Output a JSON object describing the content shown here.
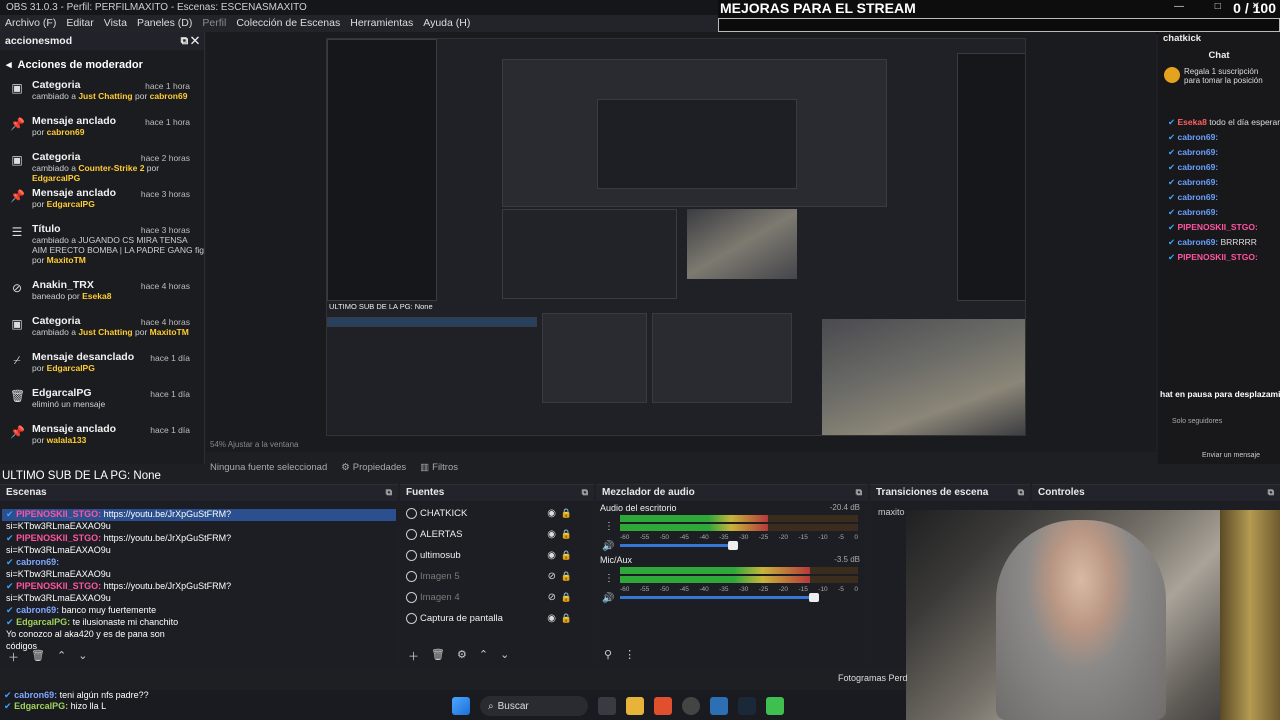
{
  "window": {
    "title": "OBS 31.0.3 - Perfil: PERFILMAXITO - Escenas: ESCENASMAXITO",
    "controls": "— □ ✕"
  },
  "menu": [
    "Archivo (F)",
    "Editar",
    "Vista",
    "Paneles (D)",
    "Perfil",
    "Colección de Escenas",
    "Herramientas",
    "Ayuda (H)"
  ],
  "goal": {
    "title": "MEJORAS PARA EL STREAM",
    "count": "0  / 100",
    "progress": 0.0
  },
  "mod_panel": {
    "dock_title": "accionesmod",
    "header": "Acciones de moderador",
    "entries": [
      {
        "icon": "category-icon",
        "title": "Categoria",
        "time": "hace 1 hora",
        "desc": "cambiado a ",
        "hl": "Just Chatting",
        "desc2": " por ",
        "user": "cabron69"
      },
      {
        "icon": "pin-icon",
        "title": "Mensaje anclado",
        "time": "hace 1 hora",
        "desc": "por ",
        "hl": "",
        "desc2": "",
        "user": "cabron69"
      },
      {
        "icon": "category-icon",
        "title": "Categoria",
        "time": "hace 2 horas",
        "desc": "cambiado a ",
        "hl": "Counter-Strike 2",
        "desc2": " por ",
        "user": "EdgarcalPG"
      },
      {
        "icon": "pin-icon",
        "title": "Mensaje anclado",
        "time": "hace 3 horas",
        "desc": "por ",
        "hl": "",
        "desc2": "",
        "user": "EdgarcalPG"
      },
      {
        "icon": "title-icon",
        "title": "Título",
        "time": "hace 3 horas",
        "desc": "cambiado a JUGANDO CS MIRA TENSA AIM ERECTO BOMBA | LA PADRE GANG fig por ",
        "hl": "",
        "desc2": "",
        "user": "MaxitoTM"
      },
      {
        "icon": "ban-icon",
        "title": "Anakin_TRX",
        "time": "hace 4 horas",
        "desc": "baneado por ",
        "hl": "",
        "desc2": "",
        "user": "Eseka8"
      },
      {
        "icon": "category-icon",
        "title": "Categoria",
        "time": "hace 4 horas",
        "desc": "cambiado a ",
        "hl": "Just Chatting",
        "desc2": " por ",
        "user": "MaxitoTM"
      },
      {
        "icon": "unpin-icon",
        "title": "Mensaje desanclado",
        "time": "hace 1 día",
        "desc": "por ",
        "hl": "",
        "desc2": "",
        "user": "EdgarcalPG"
      },
      {
        "icon": "trash-icon",
        "title": "EdgarcalPG",
        "time": "hace 1 día",
        "desc": "eliminó un mensaje",
        "hl": "",
        "desc2": "",
        "user": ""
      },
      {
        "icon": "pin-icon",
        "title": "Mensaje anclado",
        "time": "hace 1 día",
        "desc": "por ",
        "hl": "",
        "desc2": "",
        "user": "walala133"
      }
    ]
  },
  "preview": {
    "inner_status_text": "ULTIMO SUB DE LA PG: None",
    "zoom_text": "54%   Ajustar a la ventana"
  },
  "chat": {
    "dock_title": "chatkick",
    "title": "Chat",
    "promo": "Regala 1 suscripción para tomar la posición",
    "lines": [
      {
        "user": "Eseka8",
        "msg": "todo el día esperando el fila...",
        "cls": "u-esk"
      },
      {
        "user": "cabron69:",
        "msg": "",
        "cls": "u-cab"
      },
      {
        "user": "cabron69:",
        "msg": "",
        "cls": "u-cab"
      },
      {
        "user": "cabron69:",
        "msg": "",
        "cls": "u-cab"
      },
      {
        "user": "cabron69:",
        "msg": "",
        "cls": "u-cab"
      },
      {
        "user": "cabron69:",
        "msg": "",
        "cls": "u-cab"
      },
      {
        "user": "cabron69:",
        "msg": "",
        "cls": "u-cab"
      },
      {
        "user": "PIPENOSKII_STGO:",
        "msg": "",
        "cls": "u-pip"
      },
      {
        "user": "cabron69:",
        "msg": "BRRRRR",
        "cls": "u-cab"
      },
      {
        "user": "PIPENOSKII_STGO:",
        "msg": "",
        "cls": "u-pip"
      }
    ],
    "paused": "hat en pausa para desplazamie",
    "followers_only": "Solo seguidores",
    "send": "Enviar un mensaje"
  },
  "overlay_text": "ULTIMO SUB DE LA PG: None",
  "source_toolbar": {
    "no_source": "Ninguna fuente seleccionad",
    "properties": "Propiedades",
    "filters": "Filtros"
  },
  "docks": {
    "scenes": "Escenas",
    "sources": "Fuentes",
    "mixer": "Mezclador de audio",
    "transitions": "Transiciones de escena",
    "controls": "Controles"
  },
  "scene_chat": [
    {
      "name": "PIPENOSKII_STGO:",
      "msg": "https://youtu.be/JrXpGuStFRM?",
      "cls": "nm-pip",
      "hl": true
    },
    {
      "name": "",
      "msg": "si=KTbw3RLmaEAXAO9u",
      "cls": "",
      "hl": false
    },
    {
      "name": "PIPENOSKII_STGO:",
      "msg": "https://youtu.be/JrXpGuStFRM?",
      "cls": "nm-pip",
      "hl": false
    },
    {
      "name": "",
      "msg": "si=KTbw3RLmaEAXAO9u",
      "cls": "",
      "hl": false
    },
    {
      "name": "cabron69:",
      "msg": "",
      "cls": "nm-cab",
      "hl": false
    },
    {
      "name": "",
      "msg": "si=KTbw3RLmaEAXAO9u",
      "cls": "",
      "hl": false
    },
    {
      "name": "PIPENOSKII_STGO:",
      "msg": "https://youtu.be/JrXpGuStFRM?",
      "cls": "nm-pip",
      "hl": false
    },
    {
      "name": "",
      "msg": "si=KTbw3RLmaEAXAO9u",
      "cls": "",
      "hl": false
    },
    {
      "name": "cabron69:",
      "msg": "banco muy fuertemente",
      "cls": "nm-cab",
      "hl": false
    },
    {
      "name": "EdgarcalPG:",
      "msg": "te ilusionaste mi chanchito",
      "cls": "nm-edg",
      "hl": false
    },
    {
      "name": "",
      "msg": "Yo conozco al aka420 y es de pana son",
      "cls": "",
      "hl": false
    },
    {
      "name": "",
      "msg": "códigos",
      "cls": "",
      "hl": false
    }
  ],
  "sources": [
    {
      "name": "CHATKICK",
      "off": false
    },
    {
      "name": "ALERTAS",
      "off": false
    },
    {
      "name": "ultimosub",
      "off": false
    },
    {
      "name": "Imagen 5",
      "off": true
    },
    {
      "name": "Imagen 4",
      "off": true
    },
    {
      "name": "Captura de pantalla",
      "off": false
    }
  ],
  "mixer": [
    {
      "name": "Audio del escritorio",
      "db": "-20.4 dB",
      "level": 0.62,
      "fader": 0.48
    },
    {
      "name": "Mic/Aux",
      "db": "-3.5 dB",
      "level": 0.8,
      "fader": 0.82
    }
  ],
  "mixer_ticks": [
    "-60",
    "-55",
    "-50",
    "-45",
    "-40",
    "-35",
    "-30",
    "-25",
    "-20",
    "-15",
    "-10",
    "-5",
    "0"
  ],
  "transition_name": "maxito",
  "fps_text": "Fotogramas Perd",
  "taskbar": {
    "chat_line1": "teni algún nfs padre??",
    "chat_line1_user": "cabron69:",
    "chat_line2_user": "EdgarcalPG:",
    "chat_line2": "hizo lla L",
    "search": "Buscar"
  },
  "colors": {
    "accent": "#3677d6",
    "highlight": "#ffcc33",
    "pink": "#ff54a0"
  }
}
